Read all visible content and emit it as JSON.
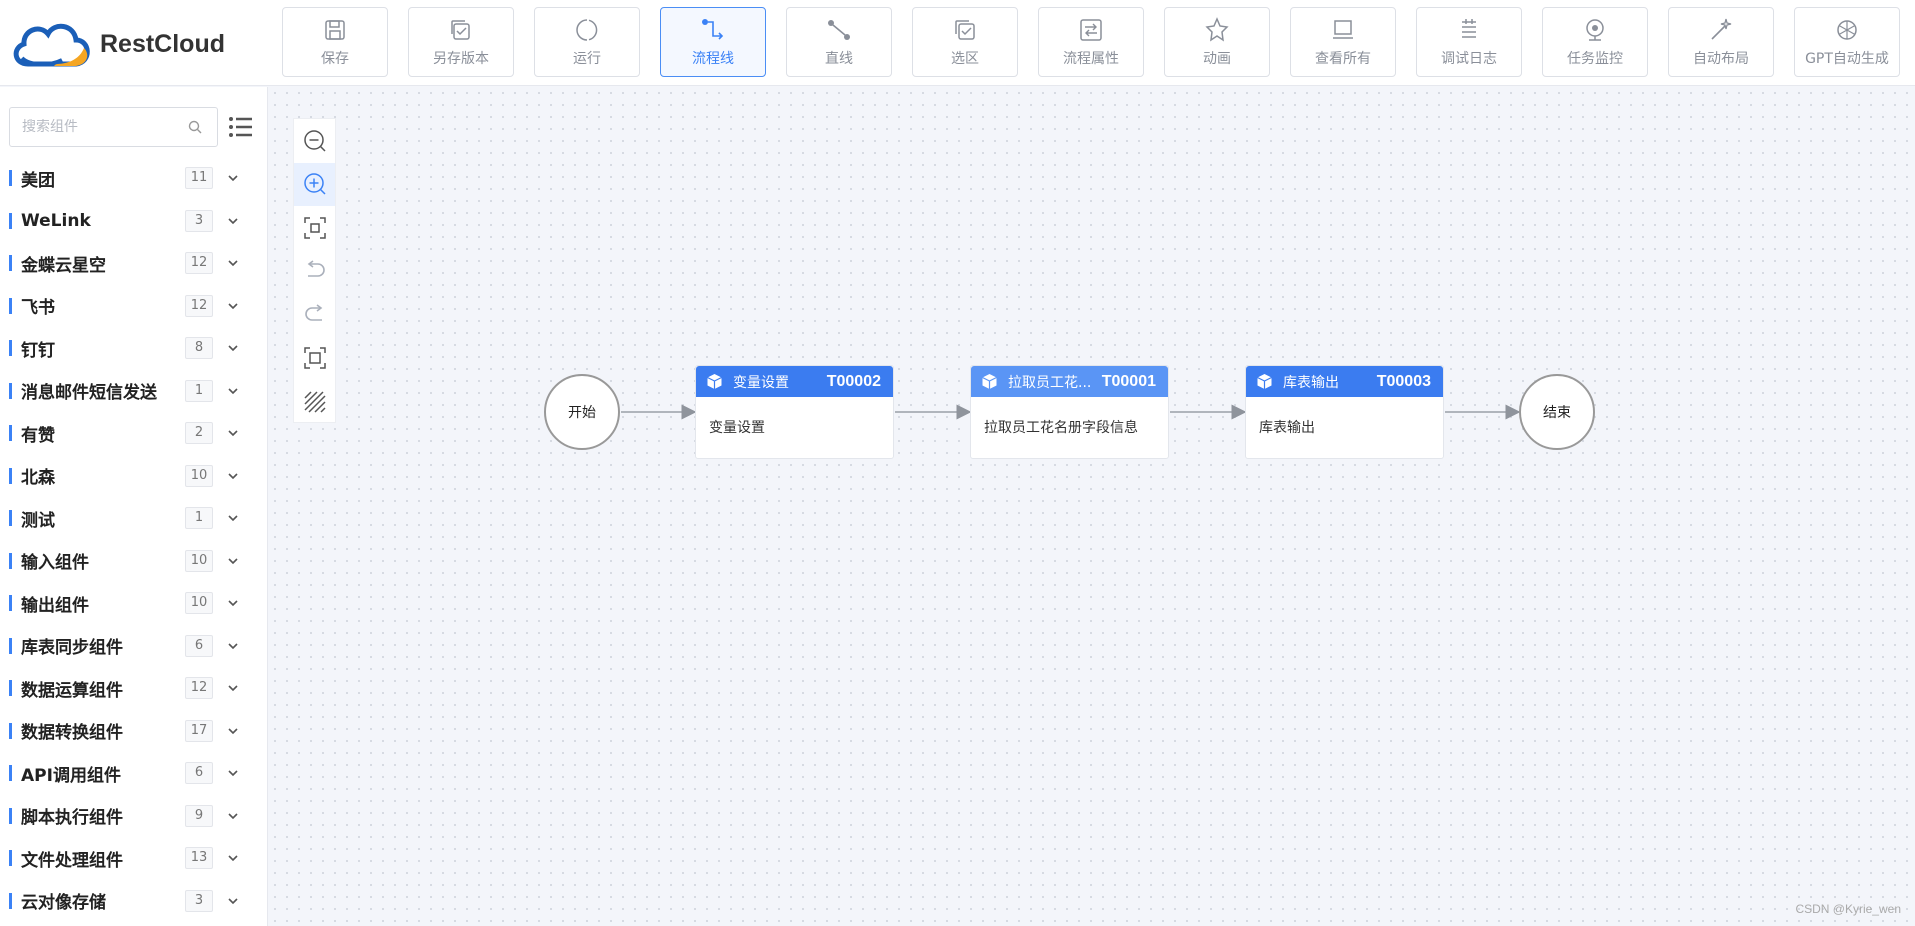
{
  "app": {
    "logo_text": "RestCloud"
  },
  "toolbar": {
    "buttons": [
      {
        "label": "保存"
      },
      {
        "label": "另存版本"
      },
      {
        "label": "运行"
      },
      {
        "label": "流程线"
      },
      {
        "label": "直线"
      },
      {
        "label": "选区"
      },
      {
        "label": "流程属性"
      },
      {
        "label": "动画"
      },
      {
        "label": "查看所有"
      },
      {
        "label": "调试日志"
      },
      {
        "label": "任务监控"
      },
      {
        "label": "自动布局"
      },
      {
        "label": "GPT自动生成"
      }
    ],
    "active_index": 3
  },
  "sidebar": {
    "search_placeholder": "搜索组件",
    "categories": [
      {
        "label": "美团",
        "count": "11"
      },
      {
        "label": "WeLink",
        "count": "3"
      },
      {
        "label": "金蝶云星空",
        "count": "12"
      },
      {
        "label": "飞书",
        "count": "12"
      },
      {
        "label": "钉钉",
        "count": "8"
      },
      {
        "label": "消息邮件短信发送",
        "count": "1"
      },
      {
        "label": "有赞",
        "count": "2"
      },
      {
        "label": "北森",
        "count": "10"
      },
      {
        "label": "测试",
        "count": "1"
      },
      {
        "label": "输入组件",
        "count": "10"
      },
      {
        "label": "输出组件",
        "count": "10"
      },
      {
        "label": "库表同步组件",
        "count": "6"
      },
      {
        "label": "数据运算组件",
        "count": "12"
      },
      {
        "label": "数据转换组件",
        "count": "17"
      },
      {
        "label": "API调用组件",
        "count": "6"
      },
      {
        "label": "脚本执行组件",
        "count": "9"
      },
      {
        "label": "文件处理组件",
        "count": "13"
      },
      {
        "label": "云对像存储",
        "count": "3"
      }
    ]
  },
  "canvas_tools": [
    "zoom-out-icon",
    "zoom-in-icon",
    "fit-view-icon",
    "undo-icon",
    "redo-icon",
    "actual-size-icon",
    "grid-toggle-icon"
  ],
  "flow": {
    "start_label": "开始",
    "end_label": "结束",
    "tasks": [
      {
        "name": "变量设置",
        "id": "T00002",
        "body": "变量设置"
      },
      {
        "name": "拉取员工花...",
        "id": "T00001",
        "body": "拉取员工花名册字段信息"
      },
      {
        "name": "库表输出",
        "id": "T00003",
        "body": "库表输出"
      }
    ]
  },
  "watermark": "CSDN @Kyrie_wen",
  "colors": {
    "primary": "#3b7cf0",
    "accent_bar": "#3b82f6"
  }
}
